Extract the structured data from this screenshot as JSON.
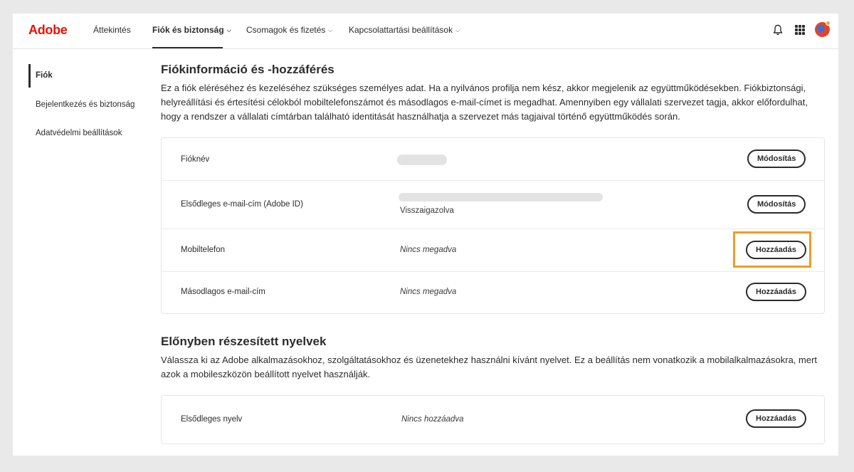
{
  "topnav": {
    "logo": "Adobe",
    "items": [
      {
        "label": "Áttekintés"
      },
      {
        "label": "Fiók és biztonság"
      },
      {
        "label": "Csomagok és fizetés"
      },
      {
        "label": "Kapcsolattartási beállítások"
      }
    ]
  },
  "sidebar": {
    "items": [
      {
        "label": "Fiók"
      },
      {
        "label": "Bejelentkezés és biztonság"
      },
      {
        "label": "Adatvédelmi beállítások"
      }
    ]
  },
  "account": {
    "title": "Fiókinformáció és -hozzáférés",
    "description": "Ez a fiók eléréséhez és kezeléséhez szükséges személyes adat. Ha a nyilvános profilja nem kész, akkor megjelenik az együttműködésekben. Fiókbiztonsági, helyreállítási és értesítési célokból mobiltelefonszámot és másodlagos e-mail-címet is megadhat. Amennyiben egy vállalati szervezet tagja, akkor előfordulhat, hogy a rendszer a vállalati címtárban található identitását használhatja a szervezet más tagjaival történő együttműködés során.",
    "rows": [
      {
        "label": "Fióknév",
        "button": "Módosítás"
      },
      {
        "label": "Elsődleges e-mail-cím (Adobe ID)",
        "status": "Visszaigazolva",
        "button": "Módosítás"
      },
      {
        "label": "Mobiltelefon",
        "value": "Nincs megadva",
        "button": "Hozzáadás"
      },
      {
        "label": "Másodlagos e-mail-cím",
        "value": "Nincs megadva",
        "button": "Hozzáadás"
      }
    ]
  },
  "languages": {
    "title": "Előnyben részesített nyelvek",
    "description": "Válassza ki az Adobe alkalmazásokhoz, szolgáltatásokhoz és üzenetekhez használni kívánt nyelvet. Ez a beállítás nem vonatkozik a mobilalkalmazásokra, mert azok a mobileszközön beállított nyelvet használják.",
    "rows": [
      {
        "label": "Elsődleges nyelv",
        "value": "Nincs hozzáadva",
        "button": "Hozzáadás"
      }
    ]
  },
  "colors": {
    "brand": "#eb1000",
    "highlight": "#f29b2b"
  }
}
